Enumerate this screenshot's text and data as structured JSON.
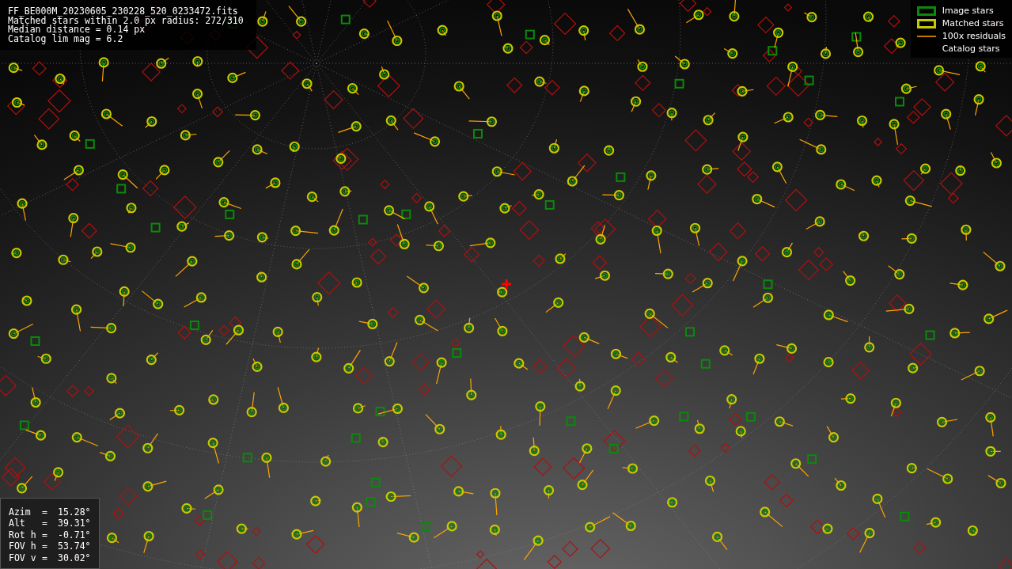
{
  "info": {
    "lines": [
      "FF_BE000M_20230605_230228_520_0233472.fits",
      "Matched stars within 2.0 px radius: 272/310",
      "Median distance = 0.14 px",
      "Catalog lim mag = 6.2"
    ]
  },
  "legend": [
    {
      "kind": "image",
      "label": "Image stars"
    },
    {
      "kind": "matched",
      "label": "Matched stars"
    },
    {
      "kind": "residual",
      "label": "100x residuals"
    },
    {
      "kind": "catalog",
      "label": "Catalog stars"
    }
  ],
  "pointing": [
    {
      "label": "Azim",
      "sign": "=",
      "value": "15.28°"
    },
    {
      "label": "Alt",
      "sign": "=",
      "value": "39.31°"
    },
    {
      "label": "Rot h",
      "sign": "=",
      "value": "-0.71°"
    },
    {
      "label": "FOV h",
      "sign": "=",
      "value": "53.74°"
    },
    {
      "label": "FOV v",
      "sign": "=",
      "value": "30.02°"
    }
  ]
}
